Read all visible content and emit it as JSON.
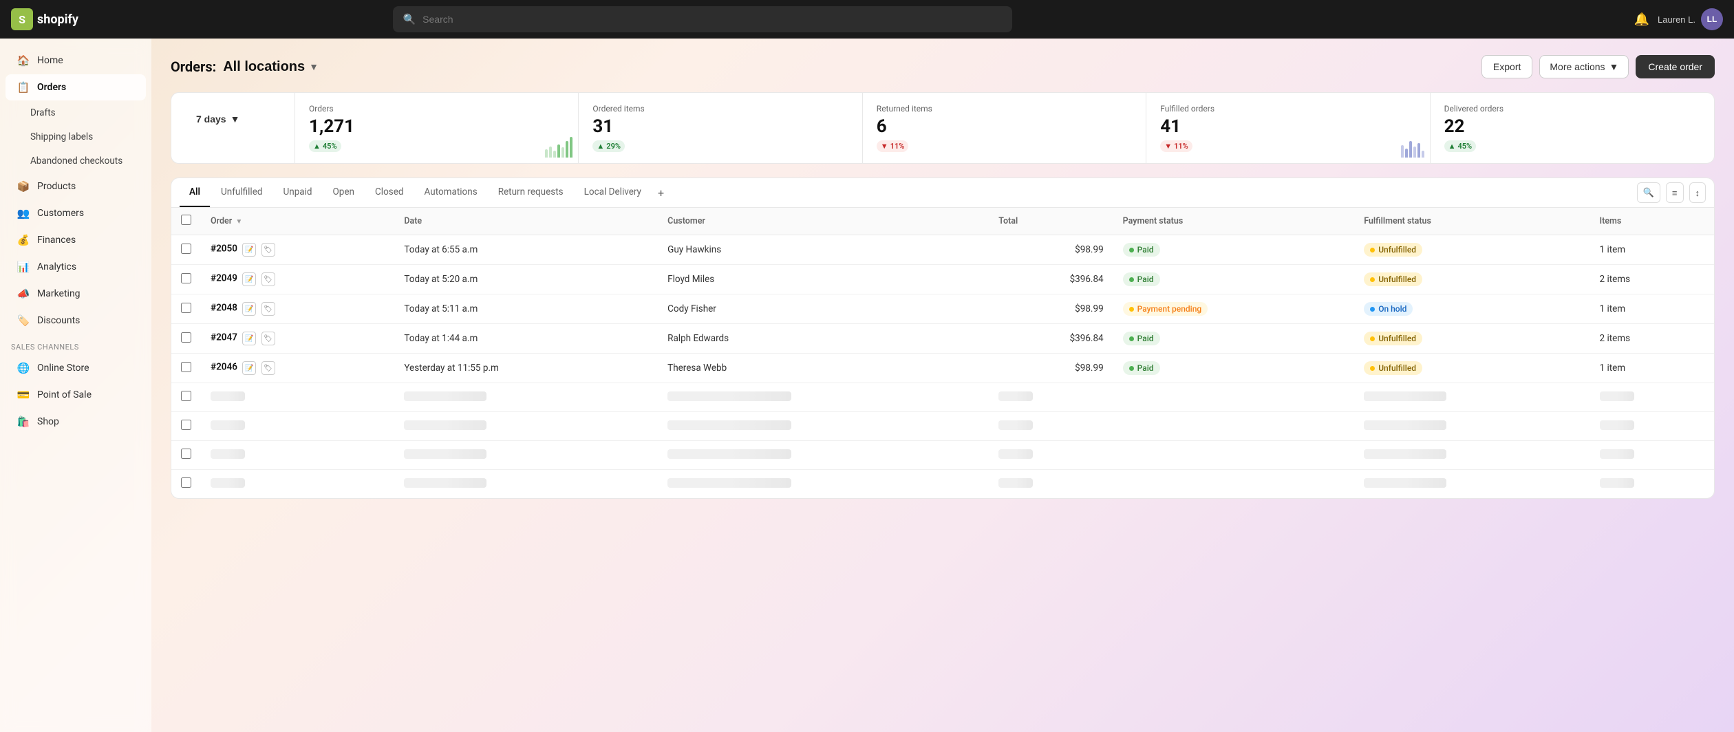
{
  "app": {
    "logo_text": "shopify",
    "search_placeholder": "Search"
  },
  "user": {
    "name": "Lauren L.",
    "initials": "LL"
  },
  "page": {
    "title": "Orders:",
    "location": "All locations",
    "colon": ":"
  },
  "header_actions": {
    "export": "Export",
    "more_actions": "More actions",
    "create_order": "Create order"
  },
  "stats": {
    "date_range": "7 days",
    "orders": {
      "label": "Orders",
      "value": "1,271",
      "badge": "45%",
      "trend": "up"
    },
    "ordered_items": {
      "label": "Ordered items",
      "value": "31",
      "badge": "29%",
      "trend": "up"
    },
    "returned_items": {
      "label": "Returned items",
      "value": "6",
      "badge": "11%",
      "trend": "down"
    },
    "fulfilled_orders": {
      "label": "Fulfilled orders",
      "value": "41",
      "badge": "11%",
      "trend": "down"
    },
    "delivered_orders": {
      "label": "Delivered orders",
      "value": "22",
      "badge": "45%",
      "trend": "up"
    }
  },
  "tabs": [
    {
      "id": "all",
      "label": "All",
      "active": true
    },
    {
      "id": "unfulfilled",
      "label": "Unfulfilled",
      "active": false
    },
    {
      "id": "unpaid",
      "label": "Unpaid",
      "active": false
    },
    {
      "id": "open",
      "label": "Open",
      "active": false
    },
    {
      "id": "closed",
      "label": "Closed",
      "active": false
    },
    {
      "id": "automations",
      "label": "Automations",
      "active": false
    },
    {
      "id": "return_requests",
      "label": "Return requests",
      "active": false
    },
    {
      "id": "local_delivery",
      "label": "Local Delivery",
      "active": false
    }
  ],
  "table": {
    "columns": [
      {
        "id": "order",
        "label": "Order"
      },
      {
        "id": "date",
        "label": "Date"
      },
      {
        "id": "customer",
        "label": "Customer"
      },
      {
        "id": "total",
        "label": "Total"
      },
      {
        "id": "payment_status",
        "label": "Payment status"
      },
      {
        "id": "fulfillment_status",
        "label": "Fulfillment status"
      },
      {
        "id": "items",
        "label": "Items"
      }
    ],
    "rows": [
      {
        "order": "#2050",
        "date": "Today at 6:55 a.m",
        "customer": "Guy Hawkins",
        "total": "$98.99",
        "payment_status": "Paid",
        "payment_badge_class": "badge-paid",
        "payment_dot": "dot-green",
        "fulfillment_status": "Unfulfilled",
        "fulfillment_badge_class": "badge-unfulfilled",
        "fulfillment_dot": "dot-yellow",
        "items": "1 item"
      },
      {
        "order": "#2049",
        "date": "Today at 5:20 a.m",
        "customer": "Floyd Miles",
        "total": "$396.84",
        "payment_status": "Paid",
        "payment_badge_class": "badge-paid",
        "payment_dot": "dot-green",
        "fulfillment_status": "Unfulfilled",
        "fulfillment_badge_class": "badge-unfulfilled",
        "fulfillment_dot": "dot-yellow",
        "items": "2 items"
      },
      {
        "order": "#2048",
        "date": "Today at 5:11 a.m",
        "customer": "Cody Fisher",
        "total": "$98.99",
        "payment_status": "Payment pending",
        "payment_badge_class": "badge-payment-pending",
        "payment_dot": "dot-yellow",
        "fulfillment_status": "On hold",
        "fulfillment_badge_class": "badge-on-hold",
        "fulfillment_dot": "dot-blue",
        "items": "1 item"
      },
      {
        "order": "#2047",
        "date": "Today at 1:44 a.m",
        "customer": "Ralph Edwards",
        "total": "$396.84",
        "payment_status": "Paid",
        "payment_badge_class": "badge-paid",
        "payment_dot": "dot-green",
        "fulfillment_status": "Unfulfilled",
        "fulfillment_badge_class": "badge-unfulfilled",
        "fulfillment_dot": "dot-yellow",
        "items": "2 items"
      },
      {
        "order": "#2046",
        "date": "Yesterday at 11:55 p.m",
        "customer": "Theresa Webb",
        "total": "$98.99",
        "payment_status": "Paid",
        "payment_badge_class": "badge-paid",
        "payment_dot": "dot-green",
        "fulfillment_status": "Unfulfilled",
        "fulfillment_badge_class": "badge-unfulfilled",
        "fulfillment_dot": "dot-yellow",
        "items": "1 item"
      }
    ]
  },
  "sidebar": {
    "nav_items": [
      {
        "id": "home",
        "label": "Home",
        "icon": "🏠",
        "active": false
      },
      {
        "id": "orders",
        "label": "Orders",
        "icon": "📋",
        "active": true
      }
    ],
    "orders_sub": [
      {
        "id": "drafts",
        "label": "Drafts"
      },
      {
        "id": "shipping_labels",
        "label": "Shipping labels"
      },
      {
        "id": "abandoned_checkouts",
        "label": "Abandoned checkouts"
      }
    ],
    "main_nav": [
      {
        "id": "products",
        "label": "Products",
        "icon": "📦"
      },
      {
        "id": "customers",
        "label": "Customers",
        "icon": "👥"
      },
      {
        "id": "finances",
        "label": "Finances",
        "icon": "💰"
      },
      {
        "id": "analytics",
        "label": "Analytics",
        "icon": "📊"
      },
      {
        "id": "marketing",
        "label": "Marketing",
        "icon": "📣"
      },
      {
        "id": "discounts",
        "label": "Discounts",
        "icon": "🏷️"
      }
    ],
    "sales_channels_title": "Sales channels",
    "sales_channels": [
      {
        "id": "online_store",
        "label": "Online Store",
        "icon": "🌐"
      },
      {
        "id": "point_of_sale",
        "label": "Point of Sale",
        "icon": "💳"
      },
      {
        "id": "shop",
        "label": "Shop",
        "icon": "🛍️"
      }
    ]
  }
}
